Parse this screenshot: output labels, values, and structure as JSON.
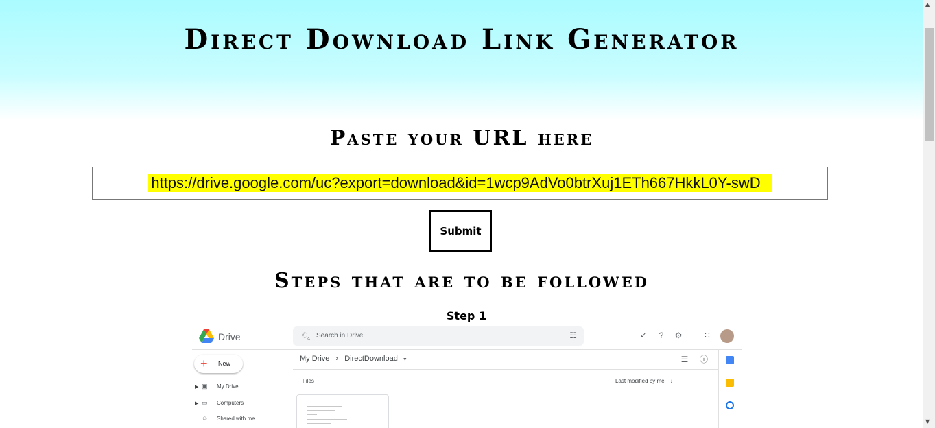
{
  "header": {
    "title": "Direct Download Link Generator"
  },
  "form": {
    "heading": "Paste your URL here",
    "url_value": "https://drive.google.com/uc?export=download&id=1wcp9AdVo0btrXuj1ETh667HkkL0Y-swD",
    "submit_label": "Submit"
  },
  "steps": {
    "heading": "Steps that are to be followed",
    "step1_label": "Step 1"
  },
  "drive_screenshot": {
    "app_name": "Drive",
    "search_placeholder": "Search in Drive",
    "new_label": "New",
    "nav": [
      "My Drive",
      "Computers",
      "Shared with me"
    ],
    "breadcrumb_root": "My Drive",
    "breadcrumb_folder": "DirectDownload",
    "files_label": "Files",
    "sort_label": "Last modified by me",
    "colors": {
      "accent": "#1a73e8",
      "yellow": "#fbbc04",
      "red": "#ea4335",
      "green": "#34a853"
    }
  }
}
